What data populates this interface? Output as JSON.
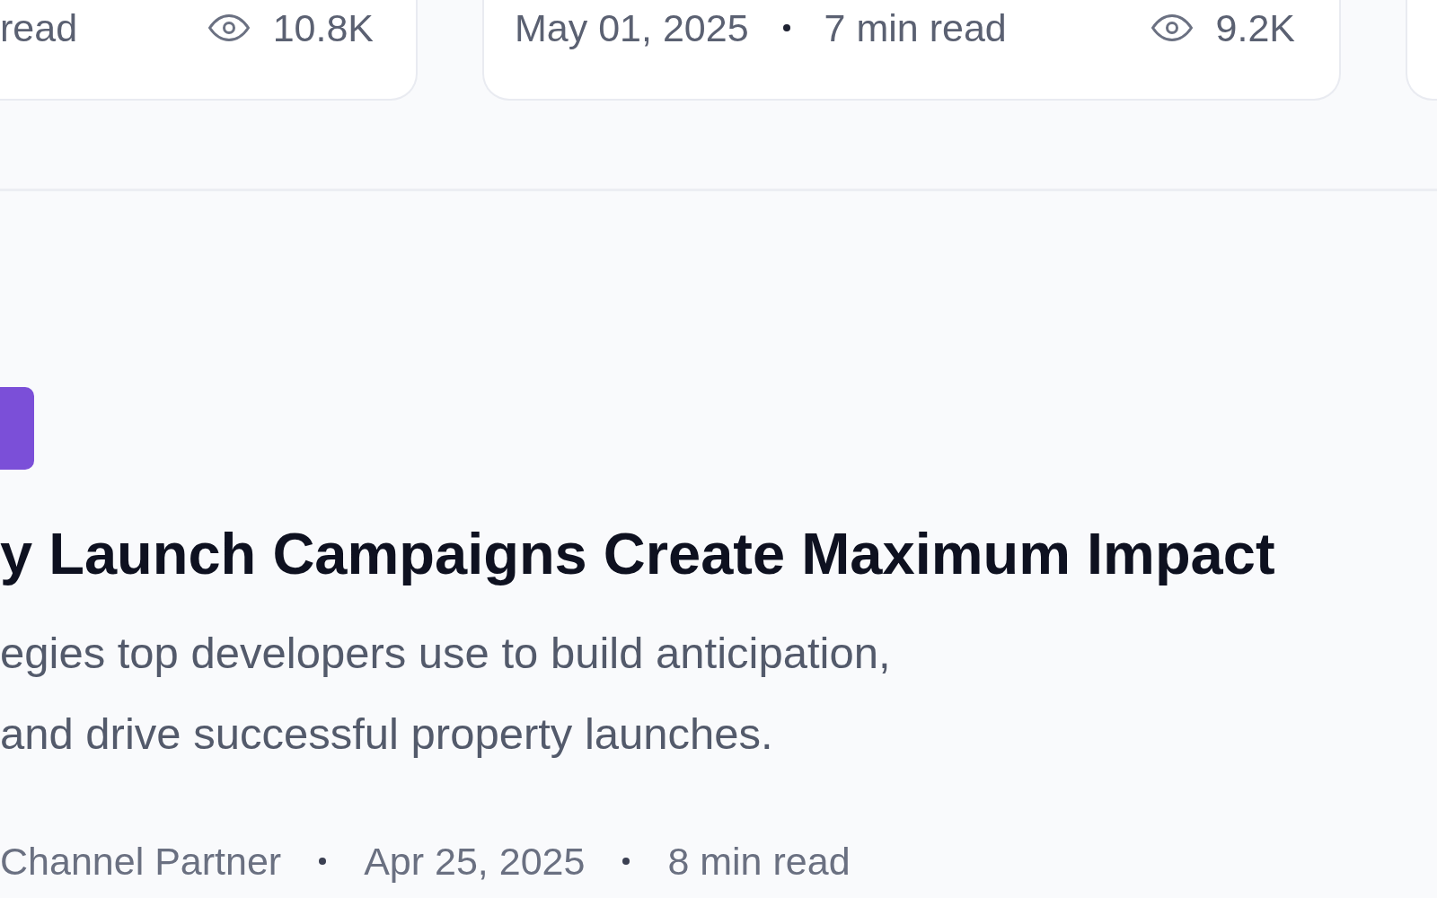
{
  "article_cards": [
    {
      "read_time": "read",
      "views": "10.8K"
    },
    {
      "date": "May 01, 2025",
      "read_time": "7 min read",
      "views": "9.2K"
    }
  ],
  "featured_article": {
    "title": "y Launch Campaigns Create Maximum Impact",
    "summary": "egies top developers use to build anticipation, and drive successful property launches.",
    "author": "Channel Partner",
    "date": "Apr 25, 2025",
    "read_time": "8 min read"
  }
}
